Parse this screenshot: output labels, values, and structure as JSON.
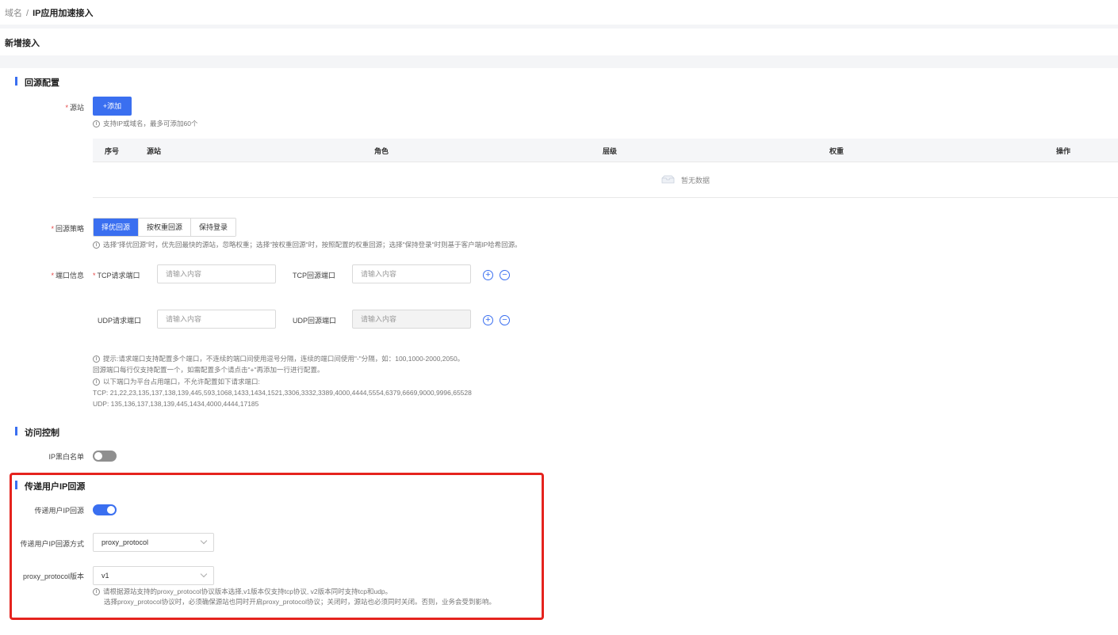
{
  "breadcrumb": {
    "root": "域名",
    "separator": "/",
    "current": "IP应用加速接入"
  },
  "page": {
    "title": "新增接入"
  },
  "origin_section": {
    "title": "回源配置",
    "origin_label": "源站",
    "add_button": "+添加",
    "add_hint": "支持IP或域名，最多可添加60个",
    "table": {
      "columns": [
        "序号",
        "源站",
        "角色",
        "层级",
        "权重",
        "操作"
      ],
      "empty_text": "暂无数据"
    },
    "strategy_label": "回源策略",
    "strategy_options": [
      "择优回源",
      "按权重回源",
      "保持登录"
    ],
    "strategy_selected": "择优回源",
    "strategy_hint": "选择\"择优回源\"时，优先回最快的源站，忽略权重；选择\"按权重回源\"时，按照配置的权重回源；选择\"保持登录\"时则基于客户端IP哈希回源。",
    "port_label": "端口信息",
    "tcp_request_label": "TCP请求端口",
    "tcp_origin_label": "TCP回源端口",
    "udp_request_label": "UDP请求端口",
    "udp_origin_label": "UDP回源端口",
    "input_placeholder": "请输入内容",
    "port_hints": [
      "提示:请求端口支持配置多个端口，不连续的端口间使用逗号分隔，连续的端口间使用\"-\"分隔，如：100,1000-2000,2050。",
      "回源端口每行仅支持配置一个，如需配置多个请点击\"+\"再添加一行进行配置。",
      "以下端口为平台占用端口，不允许配置如下请求端口:",
      "TCP: 21,22,23,135,137,138,139,445,593,1068,1433,1434,1521,3306,3332,3389,4000,4444,5554,6379,6669,9000,9996,65528",
      "UDP: 135,136,137,138,139,445,1434,4000,4444,17185"
    ]
  },
  "access_section": {
    "title": "访问控制",
    "ip_list_label": "IP黑白名单",
    "ip_list_enabled": false
  },
  "pass_ip_section": {
    "title": "传递用户IP回源",
    "toggle_label": "传递用户IP回源",
    "toggle_enabled": true,
    "method_label": "传递用户IP回源方式",
    "method_value": "proxy_protocol",
    "version_label": "proxy_protocol版本",
    "version_value": "v1",
    "hint_line1": "请根据源站支持的proxy_protocol协议版本选择,v1版本仅支持tcp协议, v2版本同时支持tcp和udp。",
    "hint_line2": "选择proxy_protocol协议时，必须确保源站也同时开启proxy_protocol协议；关闭时，源站也必须同时关闭。否则，业务会受到影响。"
  },
  "colors": {
    "accent": "#3a6ff0",
    "highlight_border": "#e5231e",
    "required": "#e54545"
  },
  "icons": [
    "info-icon",
    "empty-box-icon",
    "plus-circle-icon",
    "minus-circle-icon",
    "chevron-down-icon"
  ]
}
